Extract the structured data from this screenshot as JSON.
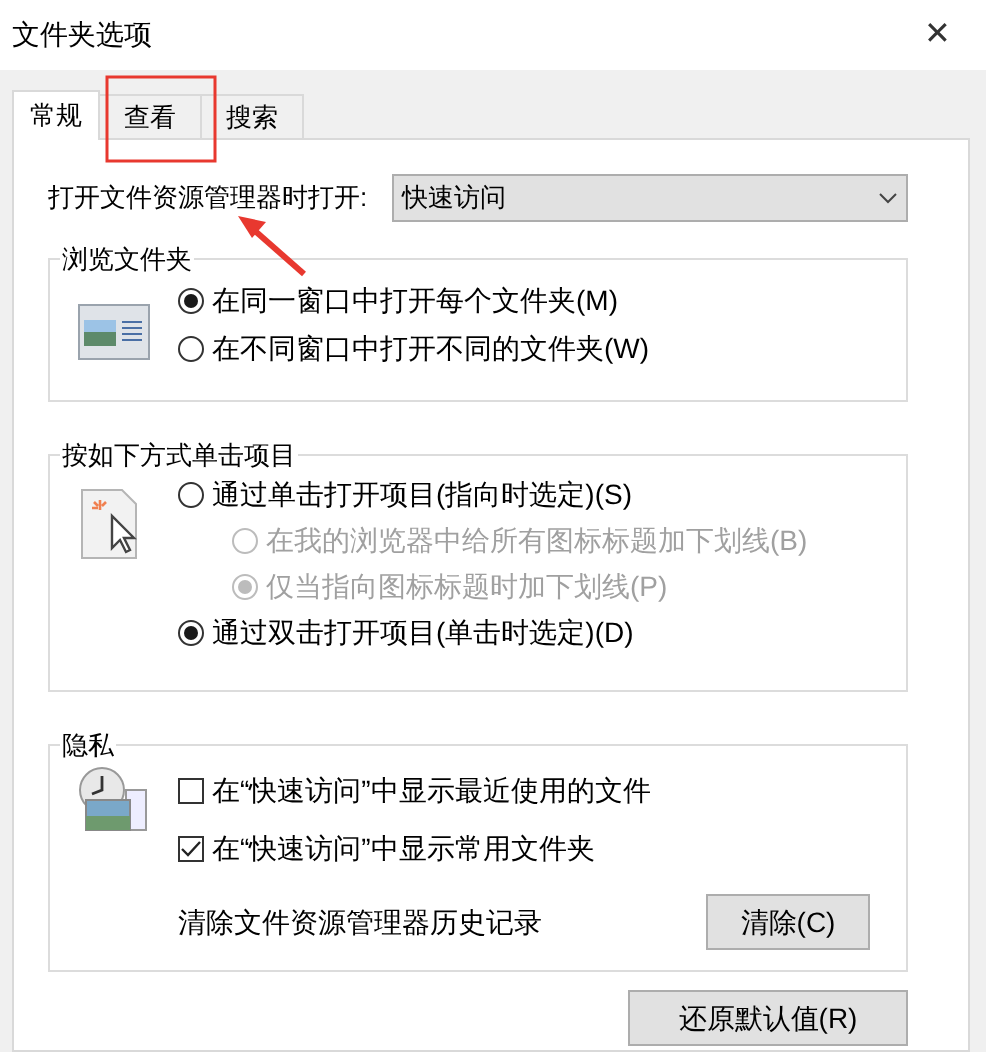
{
  "window": {
    "title": "文件夹选项",
    "close": "✕"
  },
  "tabs": [
    {
      "label": "常规",
      "selected": true
    },
    {
      "label": "查看",
      "selected": false
    },
    {
      "label": "搜索",
      "selected": false
    }
  ],
  "open_explorer": {
    "label": "打开文件资源管理器时打开:",
    "value": "快速访问"
  },
  "browse_folders": {
    "title": "浏览文件夹",
    "options": [
      {
        "label": "在同一窗口中打开每个文件夹(M)",
        "selected": true
      },
      {
        "label": "在不同窗口中打开不同的文件夹(W)",
        "selected": false
      }
    ]
  },
  "click_items": {
    "title": "按如下方式单击项目",
    "options": [
      {
        "label": "通过单击打开项目(指向时选定)(S)",
        "selected": false,
        "disabled": false,
        "children": [
          {
            "label": "在我的浏览器中给所有图标标题加下划线(B)",
            "selected": false,
            "disabled": true
          },
          {
            "label": "仅当指向图标标题时加下划线(P)",
            "selected": true,
            "disabled": true
          }
        ]
      },
      {
        "label": "通过双击打开项目(单击时选定)(D)",
        "selected": true,
        "disabled": false
      }
    ]
  },
  "privacy": {
    "title": "隐私",
    "checkboxes": [
      {
        "label": "在“快速访问”中显示最近使用的文件",
        "checked": false
      },
      {
        "label": "在“快速访问”中显示常用文件夹",
        "checked": true
      }
    ],
    "clear_label": "清除文件资源管理器历史记录",
    "clear_button": "清除(C)"
  },
  "restore_button": "还原默认值(R)"
}
